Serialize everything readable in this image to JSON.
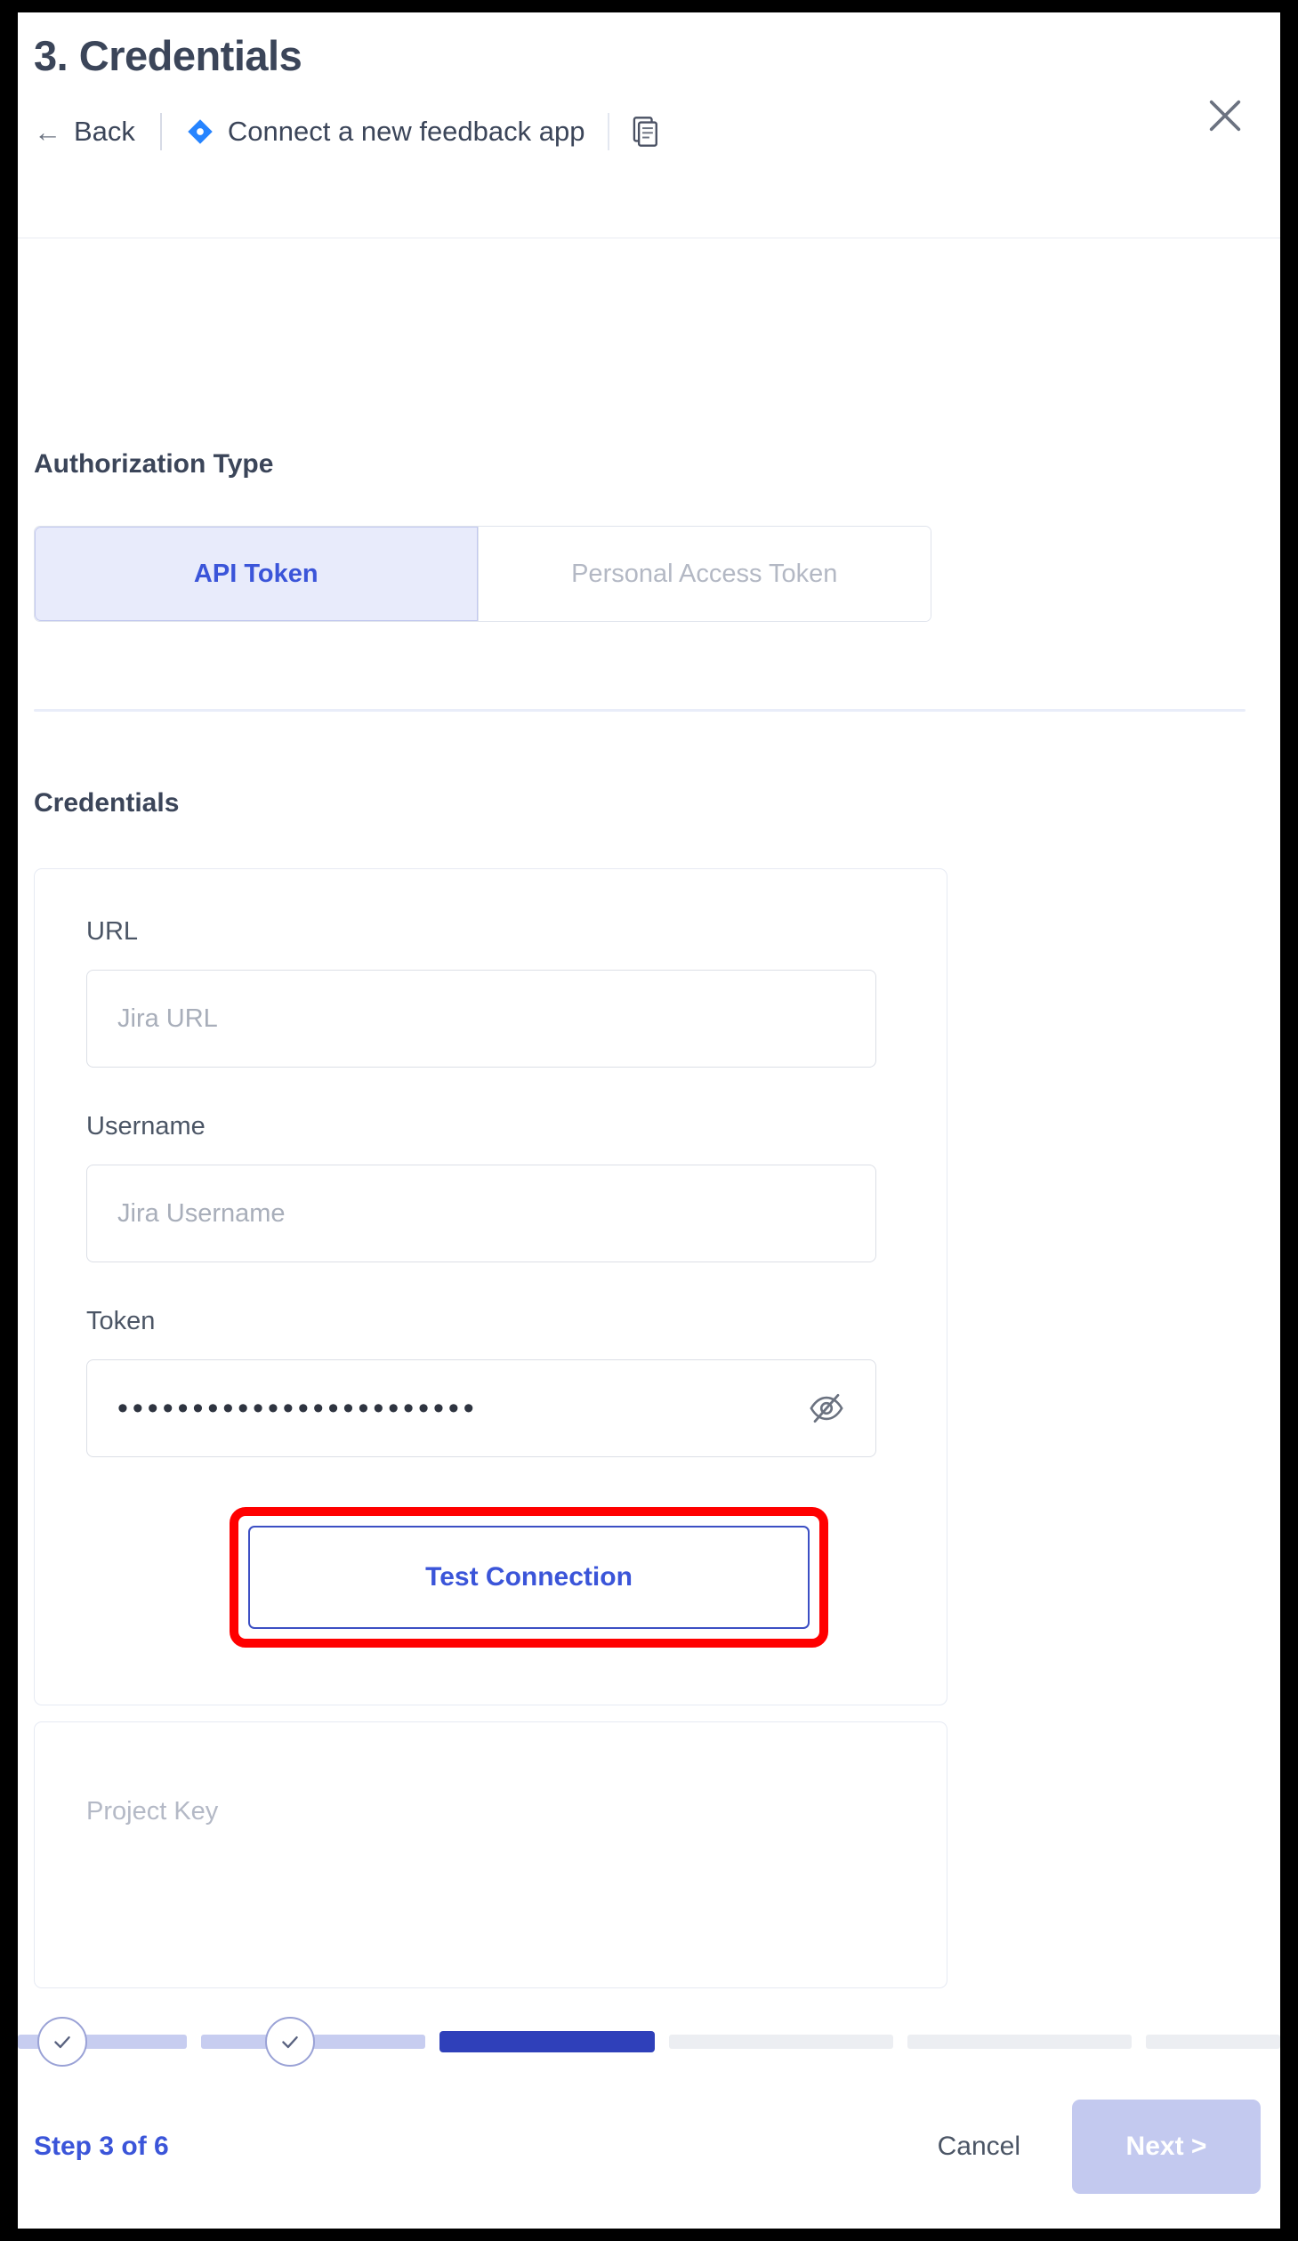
{
  "header": {
    "title": "3. Credentials",
    "back_label": "Back",
    "back_arrow_icon": "arrow-left-icon",
    "jira_icon": "jira-diamond-icon",
    "connect_label": "Connect a new feedback app",
    "doc_icon": "document-copy-icon",
    "close_icon": "close-icon"
  },
  "auth": {
    "section_title": "Authorization Type",
    "options": [
      {
        "label": "API Token",
        "selected": true
      },
      {
        "label": "Personal Access Token",
        "selected": false
      }
    ]
  },
  "credentials": {
    "section_title": "Credentials",
    "fields": [
      {
        "label": "URL",
        "placeholder": "Jira URL",
        "value": "",
        "type": "text"
      },
      {
        "label": "Username",
        "placeholder": "Jira Username",
        "value": "",
        "type": "text"
      },
      {
        "label": "Token",
        "placeholder": "",
        "value": "••••••••••••••••••••••••",
        "type": "password",
        "toggle_icon": "eye-off-icon"
      }
    ],
    "test_connection_label": "Test Connection",
    "highlight_color": "#ff0000"
  },
  "project": {
    "label": "Project Key"
  },
  "footer": {
    "step_text": "Step 3 of 6",
    "cancel_label": "Cancel",
    "next_label": "Next >",
    "progress": {
      "total_steps": 6,
      "current_step": 3,
      "completed_steps": 2,
      "check_icon": "check-circle-icon",
      "done_color": "#c7cdf0",
      "current_color": "#2f40ba",
      "todo_color": "#eceef2"
    }
  },
  "colors": {
    "accent": "#3b55d9",
    "text": "#3b4559",
    "muted": "#a8aeba",
    "jira_blue": "#2684ff"
  }
}
